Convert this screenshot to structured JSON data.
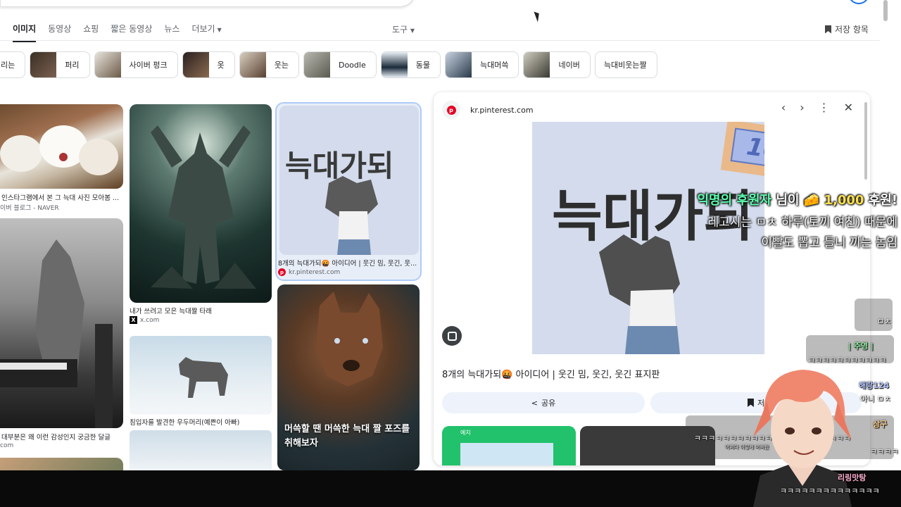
{
  "tabs": [
    {
      "label": "이미지",
      "active": true
    },
    {
      "label": "동영상"
    },
    {
      "label": "쇼핑"
    },
    {
      "label": "짧은 동영상"
    },
    {
      "label": "뉴스"
    },
    {
      "label": "더보기"
    }
  ],
  "tools_label": "도구",
  "saved_label": "저장 항목",
  "chips": [
    {
      "label": "리는",
      "color": "#ffffff"
    },
    {
      "label": "퍼리",
      "color": "#5a4a3a"
    },
    {
      "label": "사이버 펑크",
      "color": "#7a6a55"
    },
    {
      "label": "옷",
      "color": "#4a3a30"
    },
    {
      "label": "웃는",
      "color": "#6a5040"
    },
    {
      "label": "Doodle",
      "color": "#8a8a80"
    },
    {
      "label": "동물",
      "color": "#2a3a4a"
    },
    {
      "label": "늑대머쓱",
      "color": "#3a4a5a"
    },
    {
      "label": "네이버",
      "color": "#5a5a50"
    },
    {
      "label": "늑대비웃는짤",
      "color": null
    }
  ],
  "results": {
    "r1": {
      "caption": "인스타그램에서 본 그 늑대 사진 모아봄 ...",
      "source": "이버 블로그 - NAVER"
    },
    "r2": {
      "caption": "대부분은 왜 이런 감성인지 궁금한 달글",
      "source": "com"
    },
    "r3": {
      "caption": "내가 쓰려고 모은 늑대짤 타래",
      "source": "x.com"
    },
    "r4": {
      "caption": "침입자를 발견한 우두머리(예쁜이 아빠)"
    },
    "r5": {
      "image_text": "늑대가되",
      "caption": "8개의 늑대가되🤬 아이디어 | 웃긴 밈, 웃긴, 웃...",
      "source": "kr.pinterest.com"
    },
    "r6": {
      "overlay_text": "머쓱할 땐 머쓱한 늑대 짤 포즈를 취해보자"
    }
  },
  "panel": {
    "site": "kr.pinterest.com",
    "image_text": "늑대가되",
    "sticker_text": "1000",
    "title": "8개의 늑대가되🤬 아이디어 | 웃긴 밈, 웃긴, 웃긴 표지판",
    "share_label": "공유",
    "save_label": "저",
    "related_label": "예치"
  },
  "donation": {
    "name": "익명의 후원자",
    "suffix": " 님이 🧀 ",
    "amount": "1,000",
    "tail": " 후원!",
    "line1": "레고시는 ㅁㅊ 하루(토끼 여친) 때문에",
    "line2": "이빨도 뽑고 틀니 끼는 놈임"
  },
  "chat": {
    "c1": "ㅁㅊ",
    "c2_name": "| 주영 |",
    "c2_msg": "ㅋㅋㅋㅋㅋㅋㅋㅋㅋㅋㅋ",
    "c3_name": "해랑124",
    "c3_msg": "아니 ㅁㅊ",
    "c4_name": "삼구",
    "c4_msg": "ㅋㅋㅋㅋㅋㅋㅋㅋㅋㅋㅋㅋㅋㅋㅋㅋㅋㅋㅋㅋㅋㅋ",
    "c4_msg2": "ㅋㅋㅋㅋ",
    "c5_name": "리링맛탕",
    "c5_msg": "ㅋㅋㅋㅋㅋㅋㅋㅋㅋㅋㅋㅋㅋㅋ",
    "faint": "어쩌다 이렇게 머쓱한"
  },
  "colors": {
    "accent": "#1a73e8",
    "pinterest": "#e60023",
    "donation_name": "#5dffb0",
    "donation_amount": "#ffe14d"
  }
}
